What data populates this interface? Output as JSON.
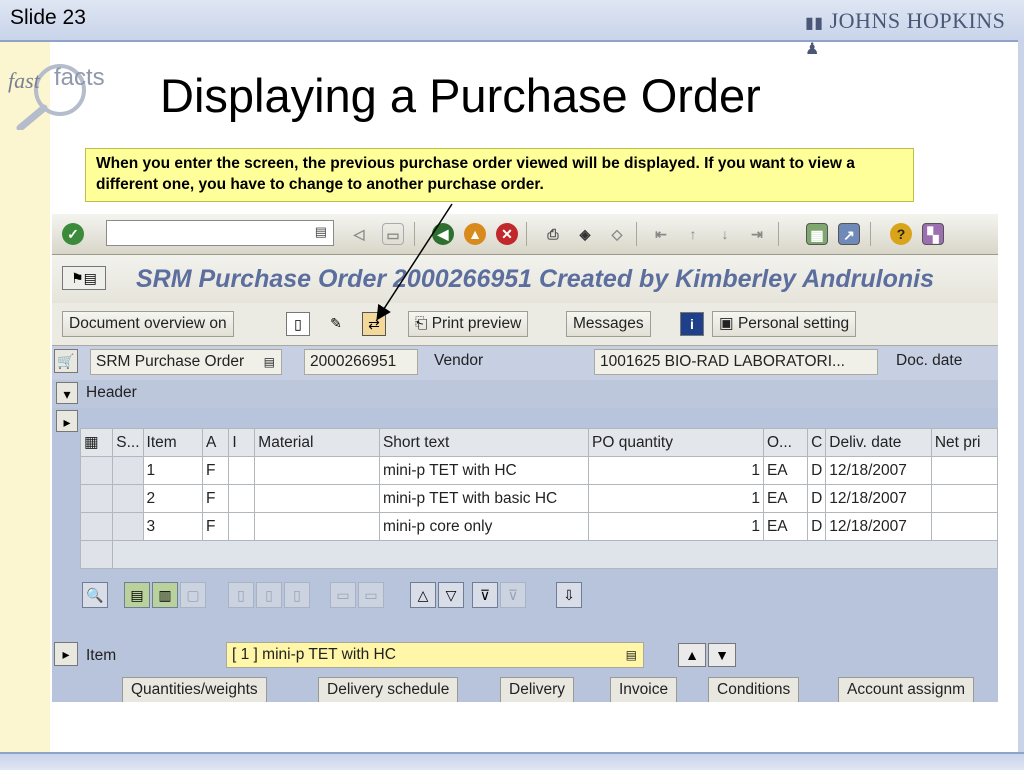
{
  "slide": {
    "number": "Slide 23",
    "logo_text": "JOHNS HOPKINS",
    "badge_fast": "fast",
    "badge_facts": "facts",
    "title": "Displaying a Purchase Order",
    "callout": "When you enter the screen, the previous purchase order viewed will be displayed.  If you want to view a different one, you have to change to another purchase order."
  },
  "sap": {
    "title": "SRM Purchase Order 2000266951 Created by Kimberley Andrulonis",
    "toolbar": {
      "document_overview": "Document overview on",
      "print_preview": "Print preview",
      "messages": "Messages",
      "personal_setting": "Personal setting"
    },
    "header_row": {
      "doc_type": "SRM Purchase Order",
      "po_number": "2000266951",
      "vendor_label": "Vendor",
      "vendor_value": "1001625 BIO-RAD LABORATORI...",
      "doc_date_label": "Doc. date"
    },
    "header_label": "Header",
    "table": {
      "columns": [
        "S...",
        "Item",
        "A",
        "I",
        "Material",
        "Short text",
        "PO quantity",
        "O...",
        "C",
        "Deliv. date",
        "Net pri"
      ],
      "rows": [
        {
          "item": "1",
          "a": "F",
          "short_text": "mini-p TET with HC",
          "qty": "1",
          "unit": "EA",
          "c": "D",
          "date": "12/18/2007"
        },
        {
          "item": "2",
          "a": "F",
          "short_text": "mini-p TET with basic HC",
          "qty": "1",
          "unit": "EA",
          "c": "D",
          "date": "12/18/2007"
        },
        {
          "item": "3",
          "a": "F",
          "short_text": "mini-p core only",
          "qty": "1",
          "unit": "EA",
          "c": "D",
          "date": "12/18/2007"
        }
      ]
    },
    "item_label": "Item",
    "item_select": "[ 1 ] mini-p TET with HC",
    "tabs": [
      "Quantities/weights",
      "Delivery schedule",
      "Delivery",
      "Invoice",
      "Conditions",
      "Account assignm"
    ]
  }
}
